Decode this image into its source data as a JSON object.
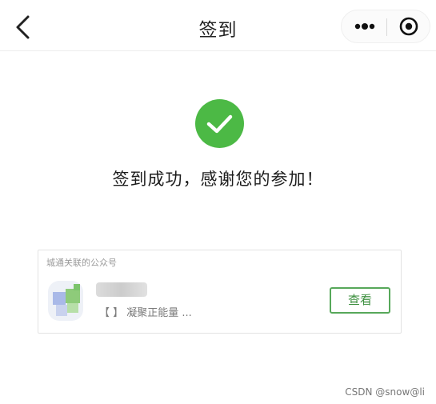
{
  "nav": {
    "title": "签到"
  },
  "success": {
    "message": "签到成功，感谢您的参加！"
  },
  "card": {
    "title": "城通关联的公众号",
    "account_description": "【        】 凝聚正能量 ...",
    "view_button": "查看"
  },
  "watermark": "CSDN @snow@li",
  "colors": {
    "success_green": "#4cb945",
    "button_border": "#57a85a",
    "button_text": "#3d8f3f"
  },
  "icons": {
    "back": "back-chevron-icon",
    "more": "more-dots-icon",
    "close": "target-close-icon",
    "success": "check-circle-icon"
  }
}
